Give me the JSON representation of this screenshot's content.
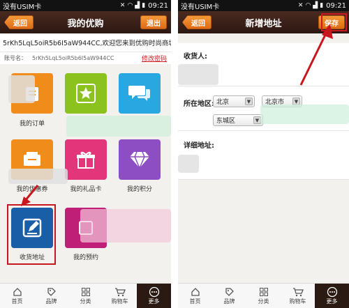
{
  "left": {
    "status": {
      "carrier": "没有USIM卡",
      "time": "09:21"
    },
    "nav": {
      "title": "我的优购",
      "back": "返回",
      "right": "退出"
    },
    "welcome": "5rKh5LqL5oiR5b6I5aW944CC,欢迎您来到优购时尚商城",
    "account": {
      "label": "账号名：",
      "value": "5rKh5LqL5oiR5b6I5aW944CC",
      "link": "修改密码"
    },
    "tiles": [
      {
        "label": "我的订单",
        "icon": "order-icon"
      },
      {
        "label": "",
        "icon": "star-icon"
      },
      {
        "label": "",
        "icon": "chat-icon"
      },
      {
        "label": "我的优惠券",
        "icon": "coupon-icon"
      },
      {
        "label": "我的礼品卡",
        "icon": "gift-icon"
      },
      {
        "label": "我的积分",
        "icon": "diamond-icon"
      },
      {
        "label": "收货地址",
        "icon": "edit-icon"
      },
      {
        "label": "我的预约",
        "icon": "reserve-icon"
      }
    ]
  },
  "right": {
    "status": {
      "carrier": "没有USIM卡",
      "time": "09:21"
    },
    "nav": {
      "title": "新增地址",
      "back": "返回",
      "right": "保存"
    },
    "form": {
      "recipient_label": "收货人:",
      "region_label": "所在地区:",
      "province": "北京",
      "city": "北京市",
      "district": "东城区",
      "detail_label": "详细地址:"
    }
  },
  "tabbar": [
    {
      "label": "首页",
      "icon": "home-icon"
    },
    {
      "label": "品牌",
      "icon": "tag-icon"
    },
    {
      "label": "分类",
      "icon": "grid-icon"
    },
    {
      "label": "购物车",
      "icon": "cart-icon"
    },
    {
      "label": "更多",
      "icon": "more-icon"
    }
  ],
  "colors": {
    "accent": "#e8761f",
    "highlight": "#c8161e",
    "navbar": "#3a2018"
  }
}
